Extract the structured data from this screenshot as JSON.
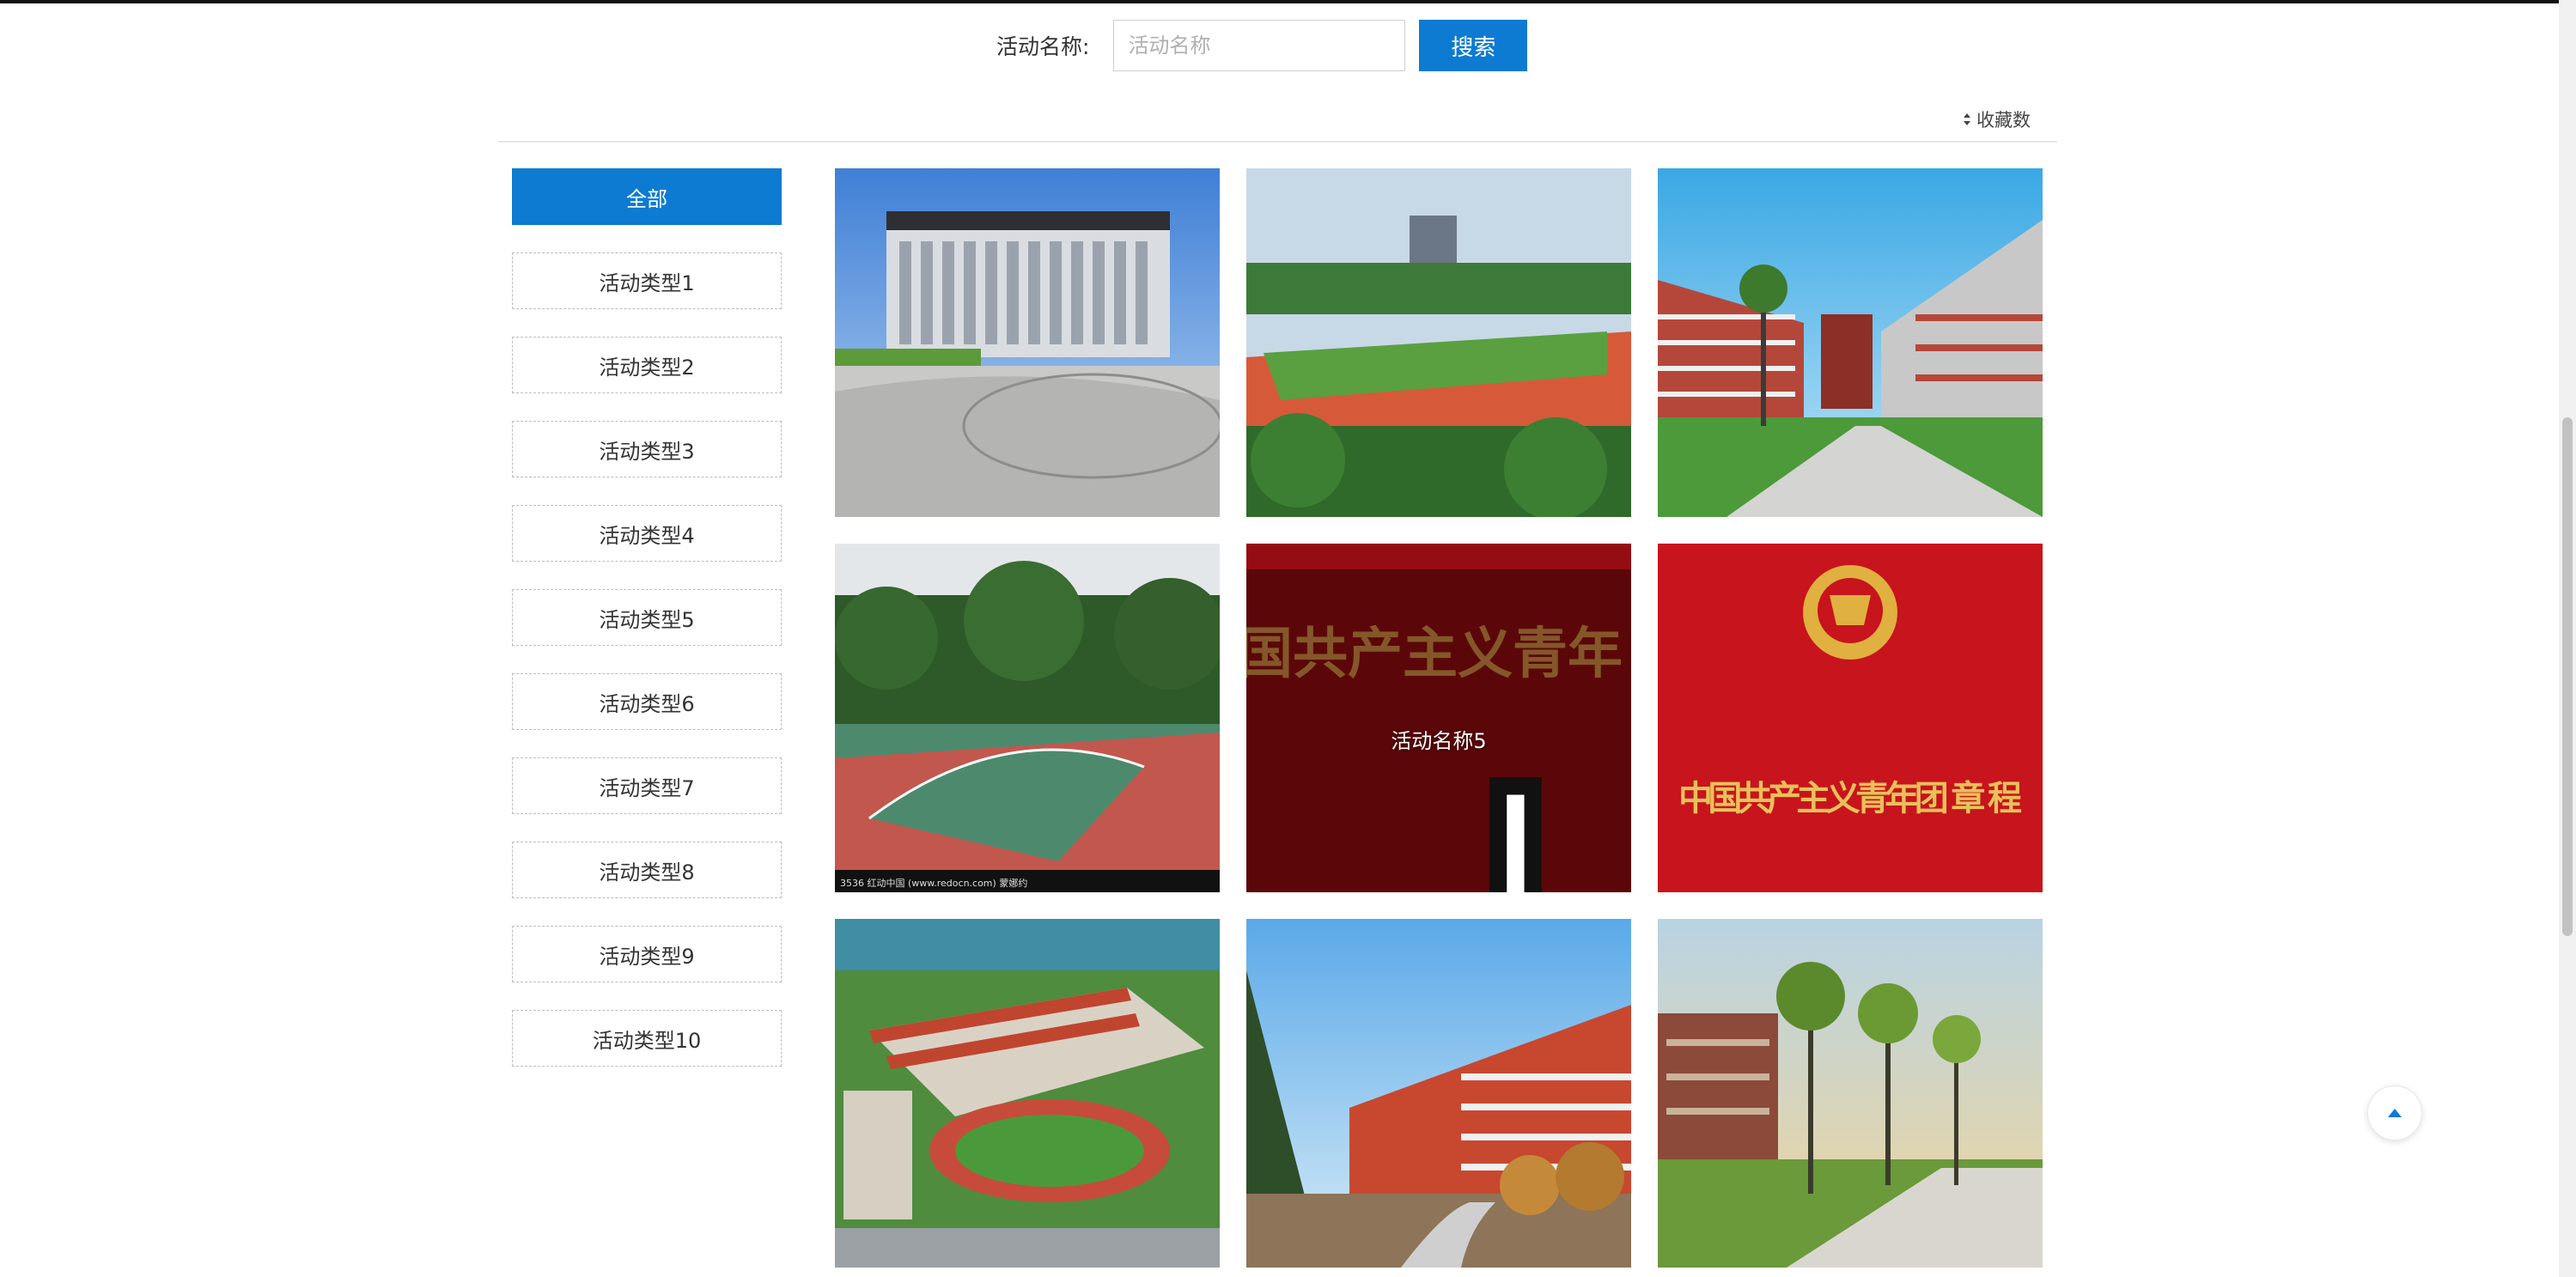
{
  "search": {
    "label": "活动名称:",
    "placeholder": "活动名称",
    "value": "",
    "button_label": "搜索"
  },
  "sort": {
    "label": "收藏数",
    "icon": "sort-icon"
  },
  "categories": [
    {
      "label": "全部",
      "active": true
    },
    {
      "label": "活动类型1",
      "active": false
    },
    {
      "label": "活动类型2",
      "active": false
    },
    {
      "label": "活动类型3",
      "active": false
    },
    {
      "label": "活动类型4",
      "active": false
    },
    {
      "label": "活动类型5",
      "active": false
    },
    {
      "label": "活动类型6",
      "active": false
    },
    {
      "label": "活动类型7",
      "active": false
    },
    {
      "label": "活动类型8",
      "active": false
    },
    {
      "label": "活动类型9",
      "active": false
    },
    {
      "label": "活动类型10",
      "active": false
    }
  ],
  "activities": [
    {
      "image": "modern-campus-building",
      "title": ""
    },
    {
      "image": "sports-field-track",
      "title": ""
    },
    {
      "image": "red-brick-school-courtyard",
      "title": ""
    },
    {
      "image": "outdoor-basketball-court",
      "title": "",
      "image_caption": "3536   红动中国 (www.redocn.com)   蒙娜约"
    },
    {
      "image": "party-charter-cover",
      "title": "活动名称5",
      "image_text": "国共产主义青年 章 程"
    },
    {
      "image": "youth-league-charter-cover",
      "title": "",
      "image_text": "中国共产主义青年团 章 程"
    },
    {
      "image": "aerial-school-campus",
      "title": ""
    },
    {
      "image": "school-building-street",
      "title": ""
    },
    {
      "image": "tree-lined-campus",
      "title": ""
    }
  ],
  "colors": {
    "accent": "#0c7bd1",
    "text": "#333333",
    "border": "#bdbdbd"
  },
  "back_to_top": {
    "icon": "arrow-up-icon"
  }
}
